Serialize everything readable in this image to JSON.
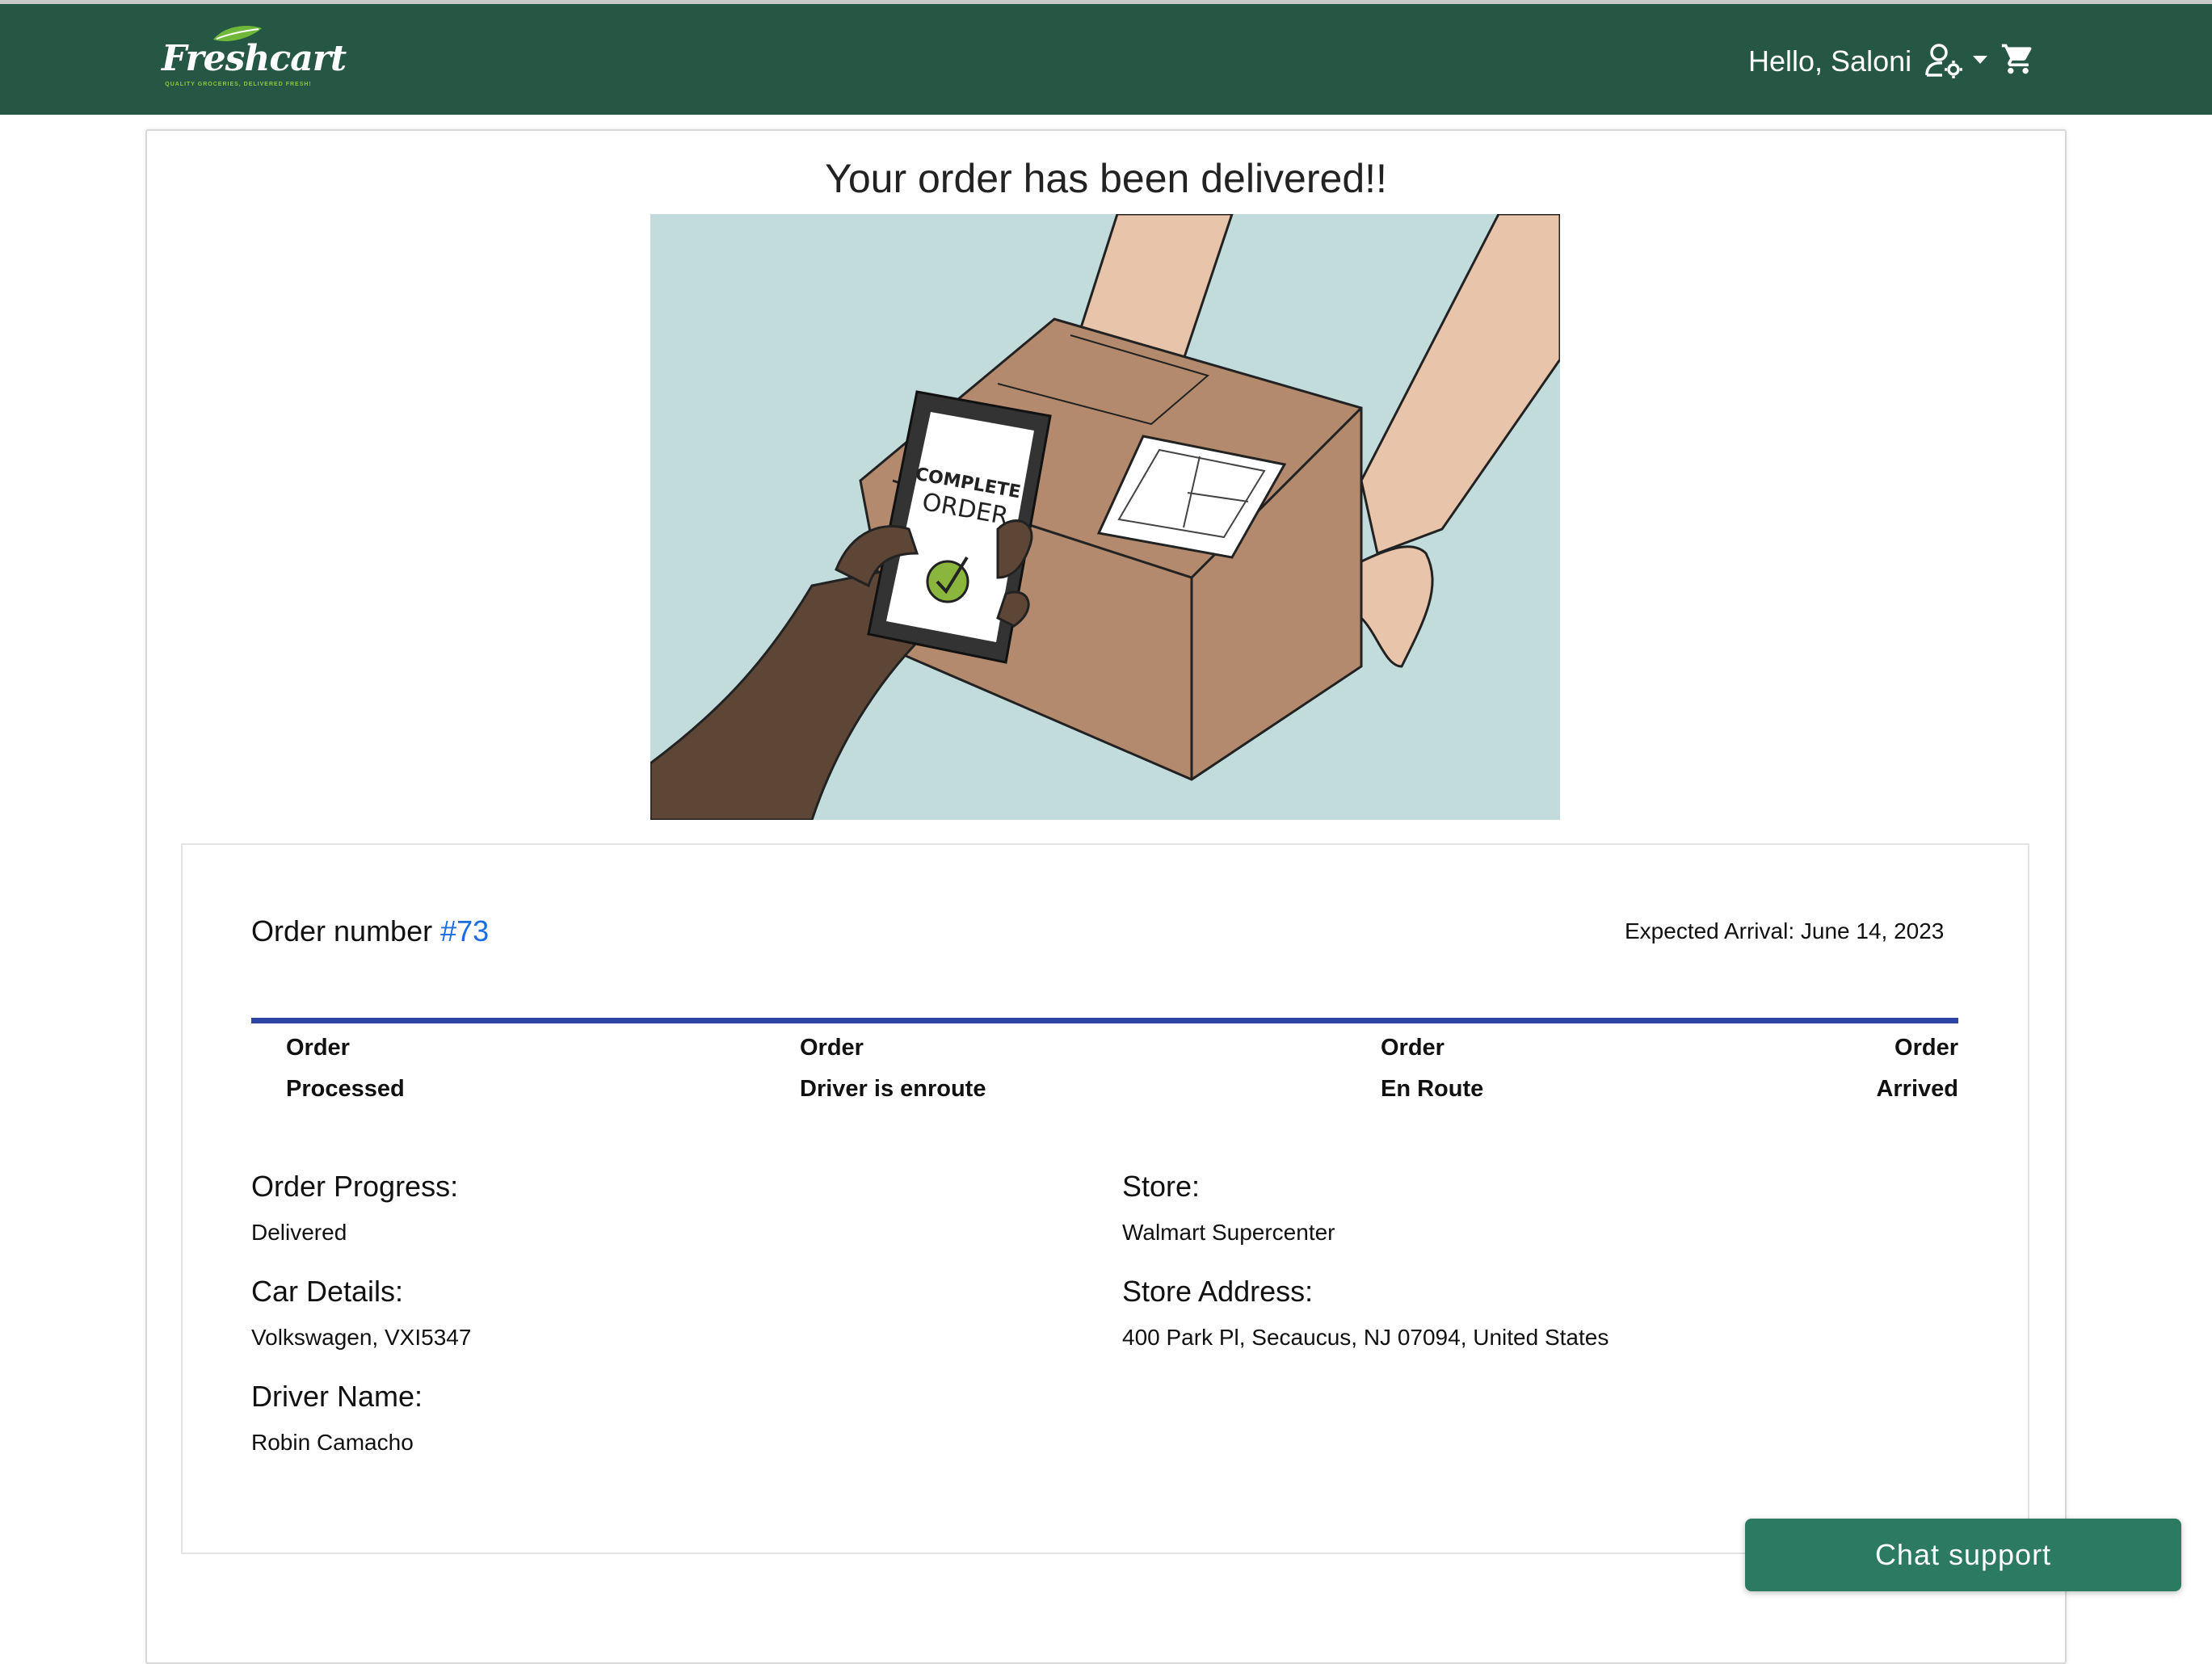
{
  "brand": {
    "name": "Freshcart",
    "tagline": "QUALITY GROCERIES, DELIVERED FRESH!",
    "nav_color": "#255744",
    "accent_link": "#1a6de0",
    "progress_color": "#2f45a6",
    "chat_color": "#2d7a62"
  },
  "header": {
    "greeting": "Hello, Saloni",
    "user_menu_icon": "user-gear-icon",
    "cart_icon": "shopping-cart-icon"
  },
  "main": {
    "title": "Your order has been delivered!!",
    "illustration": {
      "phone_line1": "COMPLETE",
      "phone_line2": "ORDER"
    }
  },
  "order": {
    "number_label": "Order number",
    "number_value": "#73",
    "expected_arrival": "Expected Arrival: June 14, 2023",
    "steps": [
      {
        "line1": "Order",
        "line2": "Processed"
      },
      {
        "line1": "Order",
        "line2": "Driver is enroute"
      },
      {
        "line1": "Order",
        "line2": "En Route"
      },
      {
        "line1": "Order",
        "line2": "Arrived"
      }
    ],
    "details": {
      "progress_label": "Order Progress:",
      "progress_value": "Delivered",
      "car_label": "Car Details:",
      "car_value": "Volkswagen, VXI5347",
      "driver_label": "Driver Name:",
      "driver_value": "Robin Camacho",
      "store_label": "Store:",
      "store_value": "Walmart Supercenter",
      "address_label": "Store Address:",
      "address_value": "400 Park Pl, Secaucus, NJ 07094, United States"
    }
  },
  "chat": {
    "label": "Chat support"
  }
}
